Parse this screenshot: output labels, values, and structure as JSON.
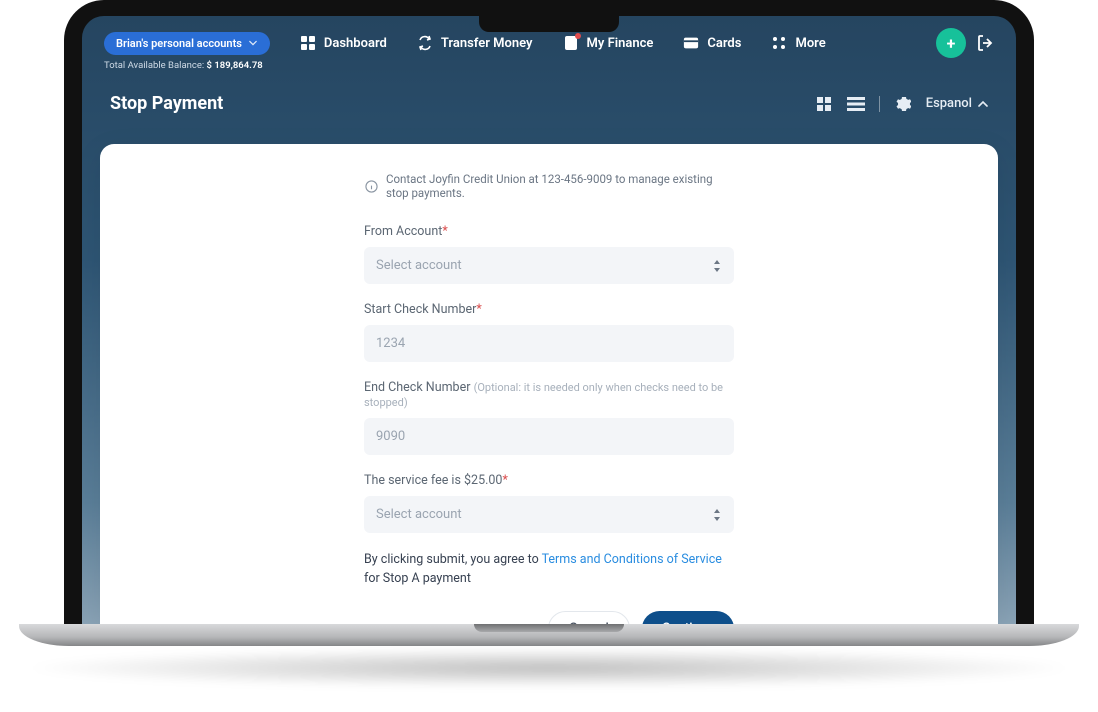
{
  "header": {
    "account_pill": "Brian's personal accounts",
    "balance_label": "Total Available Balance:",
    "balance_value": "$ 189,864.78",
    "nav": {
      "dashboard": "Dashboard",
      "transfer": "Transfer Money",
      "myfinance": "My Finance",
      "cards": "Cards",
      "more": "More"
    },
    "language": "Espanol"
  },
  "page": {
    "title": "Stop Payment",
    "info": "Contact Joyfin Credit Union at 123-456-9009 to manage existing stop payments."
  },
  "form": {
    "from_account": {
      "label": "From Account",
      "placeholder": "Select account"
    },
    "start_check": {
      "label": "Start Check Number",
      "placeholder": "1234"
    },
    "end_check": {
      "label": "End Check Number",
      "hint": "(Optional: it is needed only when checks need to be stopped)",
      "placeholder": "9090"
    },
    "fee": {
      "label": "The service fee is $25.00",
      "placeholder": "Select account"
    },
    "agree_prefix": "By clicking submit, you agree to ",
    "terms_link": "Terms and Conditions of Service",
    "agree_suffix": " for Stop A payment",
    "cancel": "Cancel",
    "continue": "Continue"
  }
}
